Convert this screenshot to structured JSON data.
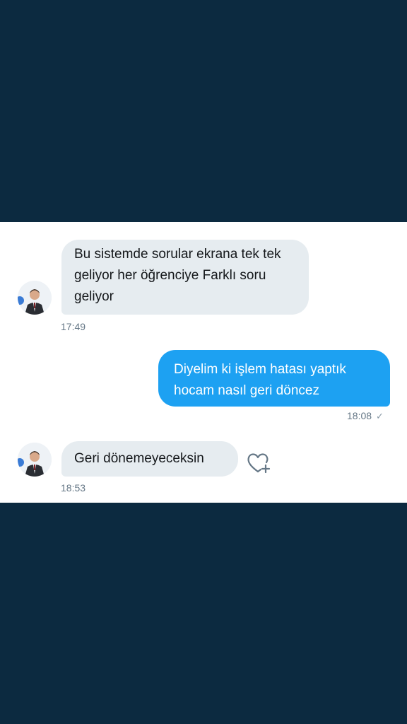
{
  "conversation": {
    "messages": [
      {
        "direction": "incoming",
        "text": "Bu sistemde sorular ekrana tek tek geliyor her öğrenciye Farklı soru geliyor",
        "time": "17:49"
      },
      {
        "direction": "outgoing",
        "text": "Diyelim ki işlem hatası yaptık hocam nasıl geri döncez",
        "time": "18:08",
        "status_icon": "check-icon"
      },
      {
        "direction": "incoming",
        "text": "Geri dönemeyeceksin",
        "time": "18:53",
        "reaction_icon": "heart-plus-icon"
      }
    ]
  },
  "colors": {
    "page_background": "#0c2a40",
    "panel_background": "#ffffff",
    "incoming_bubble": "#e6ecf0",
    "outgoing_bubble": "#1da1f2",
    "timestamp": "#657786"
  }
}
